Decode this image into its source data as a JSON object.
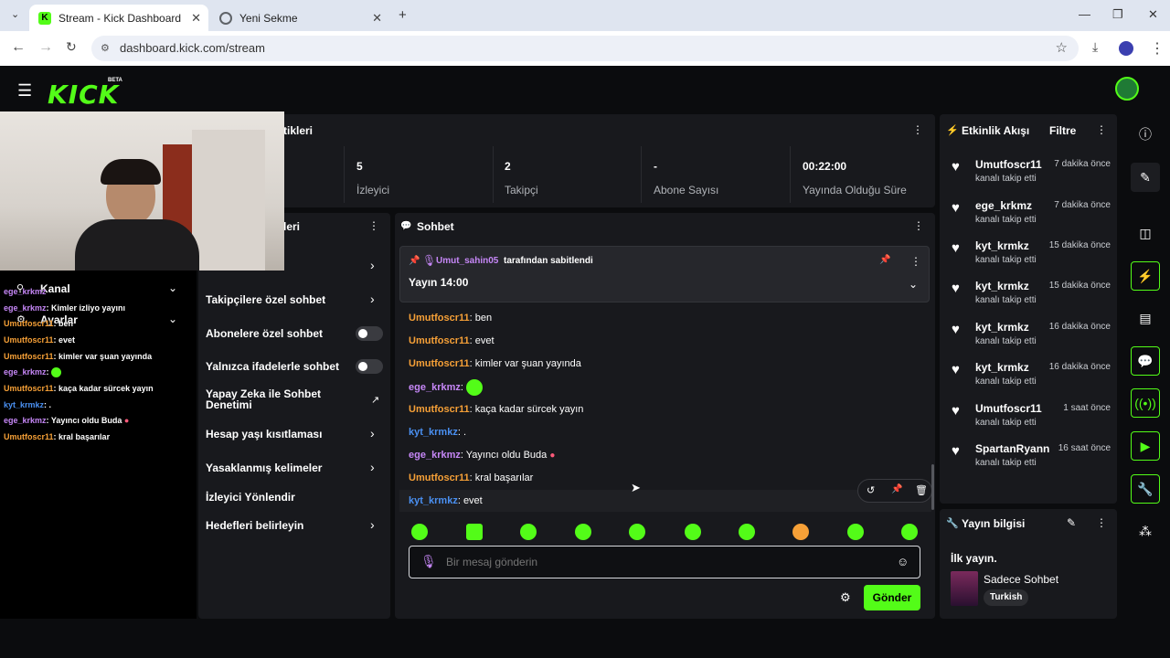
{
  "browser": {
    "tabs": [
      {
        "title": "Stream - Kick Dashboard",
        "favicon": "K"
      },
      {
        "title": "Yeni Sekme"
      }
    ],
    "url": "dashboard.kick.com/stream"
  },
  "app": {
    "logo": "KICK",
    "beta": "BETA"
  },
  "stats": {
    "title": "tikleri",
    "items": [
      {
        "value": "5",
        "label": "İzleyici"
      },
      {
        "value": "2",
        "label": "Takipçi"
      },
      {
        "value": "-",
        "label": "Abone Sayısı"
      },
      {
        "value": "00:22:00",
        "label": "Yayında Olduğu Süre"
      }
    ]
  },
  "settings": {
    "title": "leri",
    "items": [
      {
        "label": "Takipçilere özel sohbet"
      },
      {
        "label": "Abonelere özel sohbet"
      },
      {
        "label": "Yalnızca ifadelerle sohbet"
      },
      {
        "label": "Yapay Zeka ile Sohbet Denetimi"
      },
      {
        "label": "Hesap yaşı kısıtlaması"
      },
      {
        "label": "Yasaklanmış kelimeler"
      },
      {
        "label": "İzleyici Yönlendir"
      },
      {
        "label": "Hedefleri belirleyin"
      }
    ]
  },
  "overlay": {
    "menu": [
      {
        "label": "Kanal"
      },
      {
        "label": "Ayarlar"
      }
    ],
    "chat": [
      {
        "user": "ege_krkmz",
        "msg": ""
      },
      {
        "user": "ege_krkmz",
        "msg": ": Kimler izliyo yayını"
      },
      {
        "user": "Umutfoscr11",
        "msg": ": ben"
      },
      {
        "user": "Umutfoscr11",
        "msg": ": evet"
      },
      {
        "user": "Umutfoscr11",
        "msg": ": kimler var şuan yayında"
      },
      {
        "user": "ege_krkmz",
        "msg": ":"
      },
      {
        "user": "Umutfoscr11",
        "msg": ": kaça kadar sürcek yayın"
      },
      {
        "user": "kyt_krmkz",
        "msg": ": ."
      },
      {
        "user": "ege_krkmz",
        "msg": ": Yayıncı oldu Buda"
      },
      {
        "user": "Umutfoscr11",
        "msg": ": kral başarılar"
      }
    ]
  },
  "chat": {
    "title": "Sohbet",
    "pinned": {
      "user": "Umut_sahin05",
      "suffix": "tarafından sabitlendi",
      "text": "Yayın 14:00"
    },
    "messages": [
      {
        "user": "Umutfoscr11",
        "msg": ": ben"
      },
      {
        "user": "Umutfoscr11",
        "msg": ": evet"
      },
      {
        "user": "Umutfoscr11",
        "msg": ": kimler var şuan yayında"
      },
      {
        "user": "ege_krkmz",
        "msg": ":"
      },
      {
        "user": "Umutfoscr11",
        "msg": ": kaça kadar sürcek yayın"
      },
      {
        "user": "kyt_krmkz",
        "msg": ": ."
      },
      {
        "user": "ege_krkmz",
        "msg": ": Yayıncı oldu Buda"
      },
      {
        "user": "Umutfoscr11",
        "msg": ": kral başarılar"
      },
      {
        "user": "kyt_krmkz",
        "msg": ": evet"
      }
    ],
    "placeholder": "Bir mesaj gönderin",
    "send": "Gönder"
  },
  "activity": {
    "title": "Etkinlik Akışı",
    "filter": "Filtre",
    "items": [
      {
        "user": "Umutfoscr11",
        "time": "7 dakika önce",
        "action": "kanalı takip etti"
      },
      {
        "user": "ege_krkmz",
        "time": "7 dakika önce",
        "action": "kanalı takip etti"
      },
      {
        "user": "kyt_krmkz",
        "time": "15 dakika önce",
        "action": "kanalı takip etti"
      },
      {
        "user": "kyt_krmkz",
        "time": "15 dakika önce",
        "action": "kanalı takip etti"
      },
      {
        "user": "kyt_krmkz",
        "time": "16 dakika önce",
        "action": "kanalı takip etti"
      },
      {
        "user": "kyt_krmkz",
        "time": "16 dakika önce",
        "action": "kanalı takip etti"
      },
      {
        "user": "Umutfoscr11",
        "time": "1 saat önce",
        "action": "kanalı takip etti"
      },
      {
        "user": "SpartanRyann",
        "time": "16 saat önce",
        "action": "kanalı takip etti"
      }
    ]
  },
  "streaminfo": {
    "title": "Yayın bilgisi",
    "stream_title": "İlk yayın.",
    "category": "Sadece Sohbet",
    "tag": "Turkish"
  },
  "colors": {
    "brand": "#53fc18",
    "orange": "#f6a037",
    "purple": "#c687f7",
    "blue": "#4a90f2"
  }
}
